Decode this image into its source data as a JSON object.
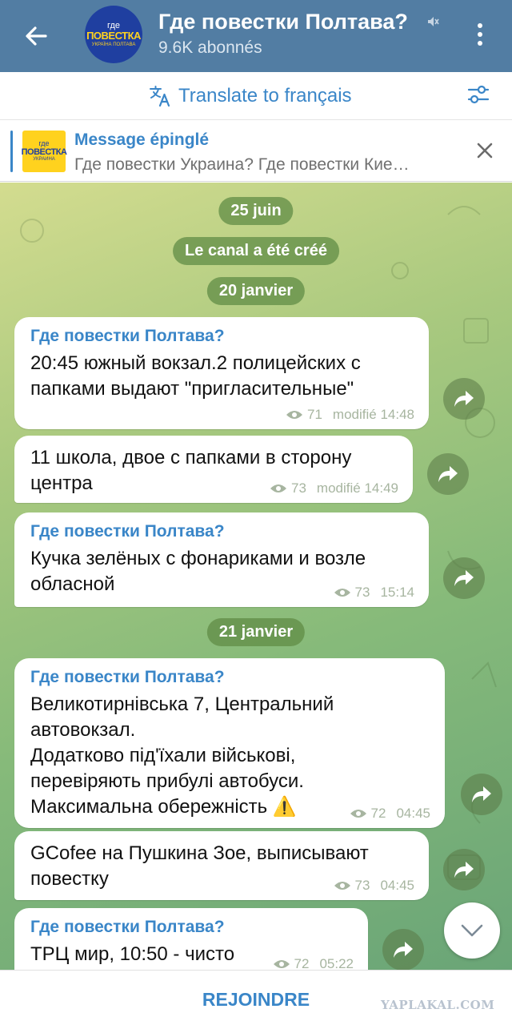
{
  "header": {
    "title": "Где повестки Полтава?",
    "subscribers": "9.6K abonnés",
    "avatar_text": {
      "top": "где",
      "middle": "ПОВЕСТКА",
      "bottom": "УКРАЇНА ПОЛТАВА"
    }
  },
  "translate": {
    "label": "Translate to français"
  },
  "pinned": {
    "title": "Message épinglé",
    "text": "Где повестки Украина? Где повестки Кие…",
    "thumb_text": {
      "top": "где",
      "middle": "ПОВЕСТКА",
      "bottom": "УКРАИНА"
    }
  },
  "chat": {
    "dates": [
      "25 juin",
      "20 janvier",
      "21 janvier"
    ],
    "service_message": "Le canal a été créé",
    "messages": [
      {
        "author": "Где повестки Полтава?",
        "text": "20:45 южный вокзал.2 полицейских с папками выдают \"пригласительные\"",
        "views": "71",
        "time": "modifié 14:48"
      },
      {
        "author": "",
        "text": "11 школа, двое с папками в сторону центра",
        "views": "73",
        "time": "modifié 14:49"
      },
      {
        "author": "Где повестки Полтава?",
        "text": "Кучка зелёных с фонариками и возле обласной",
        "views": "73",
        "time": "15:14"
      },
      {
        "author": "Где повестки Полтава?",
        "text": "Великотирнівська 7, Центральний автовокзал.\nДодатково під'їхали військові, перевіряють прибулі автобуси.\nМаксимальна обережність ⚠️",
        "views": "72",
        "time": "04:45"
      },
      {
        "author": "",
        "text": "GCofee на Пушкина Зое, выписывают повестку",
        "views": "73",
        "time": "04:45"
      },
      {
        "author": "Где повестки Полтава?",
        "text": "ТРЦ мир, 10:50 - чисто",
        "views": "72",
        "time": "05:22"
      }
    ]
  },
  "bottom": {
    "join_label": "REJOINDRE",
    "watermark": "YAPLAKAL.COM"
  },
  "colors": {
    "header": "#527da3",
    "accent": "#3a86c8",
    "bubble": "#ffffff"
  },
  "icons": [
    "back-arrow-icon",
    "mute-icon",
    "more-icon",
    "translate-icon",
    "settings-sliders-icon",
    "close-icon",
    "eye-icon",
    "forward-icon",
    "chevron-down-icon"
  ]
}
